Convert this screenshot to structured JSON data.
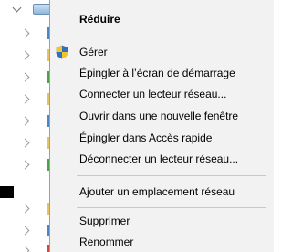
{
  "context_menu": {
    "items": [
      {
        "label": "Réduire",
        "bold": true
      },
      {
        "label": "Gérer",
        "icon": "uac-shield-icon"
      },
      {
        "label": "Épingler à l’écran de démarrage"
      },
      {
        "label": "Connecter un lecteur réseau..."
      },
      {
        "label": "Ouvrir dans une nouvelle fenêtre"
      },
      {
        "label": "Épingler dans Accès rapide"
      },
      {
        "label": "Déconnecter un lecteur réseau..."
      },
      {
        "label": "Ajouter un emplacement réseau"
      },
      {
        "label": "Supprimer"
      },
      {
        "label": "Renommer"
      }
    ]
  },
  "colors": {
    "menu_background": "#f2f2f2",
    "separator": "#c8c8c8",
    "shield_blue": "#2f6fc4",
    "shield_yellow": "#f3c623"
  }
}
